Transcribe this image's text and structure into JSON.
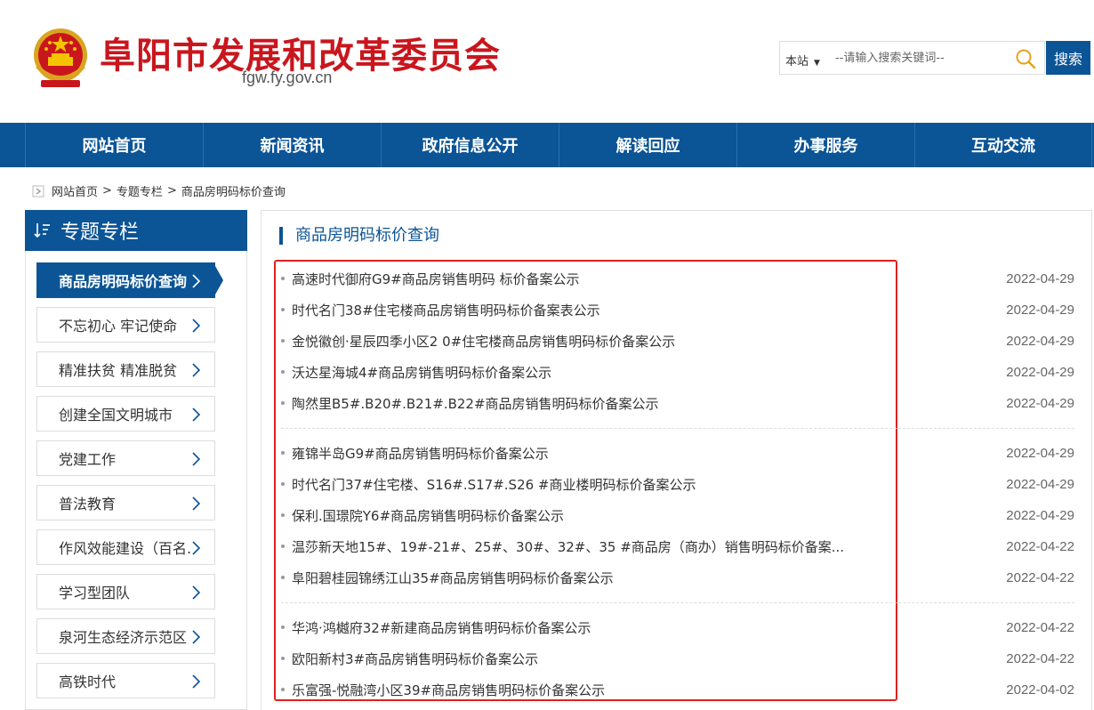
{
  "header": {
    "title": "阜阳市发展和改革委员会",
    "domain": "fgw.fy.gov.cn",
    "emblem_icon": "national-emblem-icon"
  },
  "search": {
    "scope": "本站",
    "placeholder": "--请输入搜索关键词--",
    "button_label": "搜索"
  },
  "nav": {
    "items": [
      {
        "label": "网站首页"
      },
      {
        "label": "新闻资讯"
      },
      {
        "label": "政府信息公开"
      },
      {
        "label": "解读回应"
      },
      {
        "label": "办事服务"
      },
      {
        "label": "互动交流"
      }
    ]
  },
  "breadcrumb": {
    "items": [
      "网站首页",
      "专题专栏",
      "商品房明码标价查询"
    ],
    "separator": ">"
  },
  "sidebar": {
    "title": "专题专栏",
    "items": [
      {
        "label": "商品房明码标价查询",
        "active": true
      },
      {
        "label": "不忘初心 牢记使命"
      },
      {
        "label": "精准扶贫 精准脱贫"
      },
      {
        "label": "创建全国文明城市"
      },
      {
        "label": "党建工作"
      },
      {
        "label": "普法教育"
      },
      {
        "label": "作风效能建设（百名..."
      },
      {
        "label": "学习型团队"
      },
      {
        "label": "泉河生态经济示范区"
      },
      {
        "label": "高铁时代"
      }
    ]
  },
  "main": {
    "title": "商品房明码标价查询",
    "groups": [
      [
        {
          "title": "高速时代御府G9#商品房销售明码 标价备案公示",
          "date": "2022-04-29"
        },
        {
          "title": "时代名门38#住宅楼商品房销售明码标价备案表公示",
          "date": "2022-04-29"
        },
        {
          "title": "金悦徽创·星辰四季小区2 0#住宅楼商品房销售明码标价备案公示",
          "date": "2022-04-29"
        },
        {
          "title": "沃达星海城4#商品房销售明码标价备案公示",
          "date": "2022-04-29"
        },
        {
          "title": "陶然里B5#.B20#.B21#.B22#商品房销售明码标价备案公示",
          "date": "2022-04-29"
        }
      ],
      [
        {
          "title": "雍锦半岛G9#商品房销售明码标价备案公示",
          "date": "2022-04-29"
        },
        {
          "title": "时代名门37#住宅楼、S16#.S17#.S26 #商业楼明码标价备案公示",
          "date": "2022-04-29"
        },
        {
          "title": "保利.国璟院Y6#商品房销售明码标价备案公示",
          "date": "2022-04-29"
        },
        {
          "title": "温莎新天地15#、19#-21#、25#、30#、32#、35 #商品房（商办）销售明码标价备案...",
          "date": "2022-04-22"
        },
        {
          "title": "阜阳碧桂园锦绣江山35#商品房销售明码标价备案公示",
          "date": "2022-04-22"
        }
      ],
      [
        {
          "title": "华鸿·鸿樾府32#新建商品房销售明码标价备案公示",
          "date": "2022-04-22"
        },
        {
          "title": "欧阳新村3#商品房销售明码标价备案公示",
          "date": "2022-04-22"
        },
        {
          "title": "乐富强-悦融湾小区39#商品房销售明码标价备案公示",
          "date": "2022-04-02"
        }
      ]
    ]
  }
}
